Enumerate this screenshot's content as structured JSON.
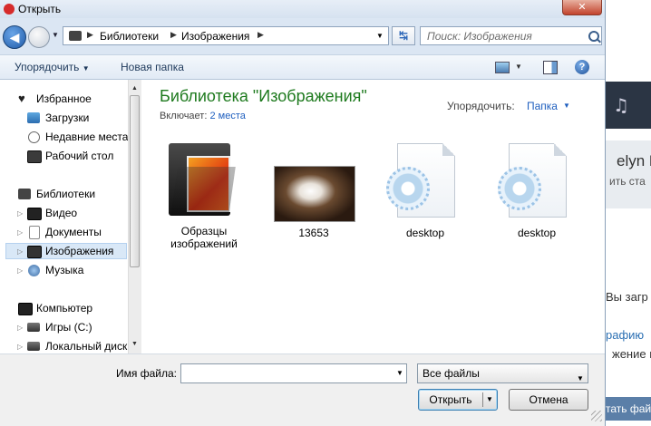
{
  "window": {
    "title": "Открыть",
    "close_label": "✕"
  },
  "address": {
    "crumbs": [
      "Библиотеки",
      "Изображения"
    ],
    "search_placeholder": "Поиск: Изображения"
  },
  "toolbar": {
    "organize_label": "Упорядочить",
    "new_folder_label": "Новая папка",
    "help_label": "?"
  },
  "nav": {
    "favorites": {
      "label": "Избранное",
      "items": [
        "Загрузки",
        "Недавние места",
        "Рабочий стол"
      ]
    },
    "libraries": {
      "label": "Библиотеки",
      "items": [
        "Видео",
        "Документы",
        "Изображения",
        "Музыка"
      ]
    },
    "computer": {
      "label": "Компьютер",
      "items": [
        "Игры (C:)",
        "Локальный диск"
      ]
    }
  },
  "content": {
    "title": "Библиотека \"Изображения\"",
    "includes_label": "Включает:",
    "includes_link": "2 места",
    "arrange_label": "Упорядочить:",
    "arrange_value": "Папка",
    "files": [
      {
        "name": "Образцы изображений",
        "kind": "folder"
      },
      {
        "name": "13653",
        "kind": "photo"
      },
      {
        "name": "desktop",
        "kind": "settings-file"
      },
      {
        "name": "desktop",
        "kind": "settings-file"
      }
    ]
  },
  "bottom": {
    "filename_label": "Имя файла:",
    "filename_value": "",
    "filetype_value": "Все файлы",
    "open_label": "Открыть",
    "cancel_label": "Отмена"
  },
  "background": {
    "text1": "elyn M",
    "text2": "ить ста",
    "text3": "Вы загр",
    "text4": "рафию",
    "text5": "жение в",
    "button": "тать фай"
  },
  "colors": {
    "library_title": "#1e7a1e",
    "link": "#1f5fbf",
    "selection": "#d9e8f7"
  }
}
